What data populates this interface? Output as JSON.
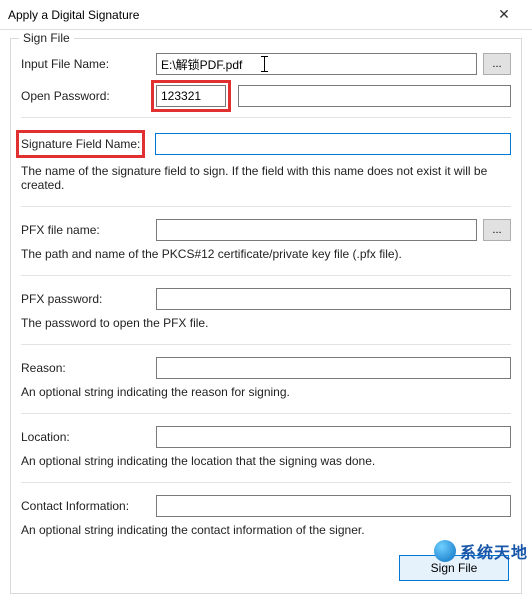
{
  "window": {
    "title": "Apply a Digital Signature"
  },
  "group": {
    "legend": "Sign File"
  },
  "inputFile": {
    "label": "Input File Name:",
    "value": "E:\\解锁PDF.pdf",
    "browse": "..."
  },
  "openPassword": {
    "label": "Open Password:",
    "value": "123321"
  },
  "sigField": {
    "label": "Signature Field Name:",
    "value": "",
    "help": "The name of the signature field to sign. If the field with this name does not exist it will be created."
  },
  "pfxFile": {
    "label": "PFX file name:",
    "value": "",
    "browse": "...",
    "help": "The path and name of the PKCS#12 certificate/private key file (.pfx file)."
  },
  "pfxPassword": {
    "label": "PFX password:",
    "value": "",
    "help": "The password to open the PFX file."
  },
  "reason": {
    "label": "Reason:",
    "value": "",
    "help": "An optional string indicating the reason for signing."
  },
  "location": {
    "label": "Location:",
    "value": "",
    "help": "An optional string indicating the location that the signing was done."
  },
  "contact": {
    "label": "Contact Information:",
    "value": "",
    "help": "An optional string indicating the contact information of the signer."
  },
  "actions": {
    "sign": "Sign File"
  },
  "watermark": {
    "text": "系统天地"
  }
}
